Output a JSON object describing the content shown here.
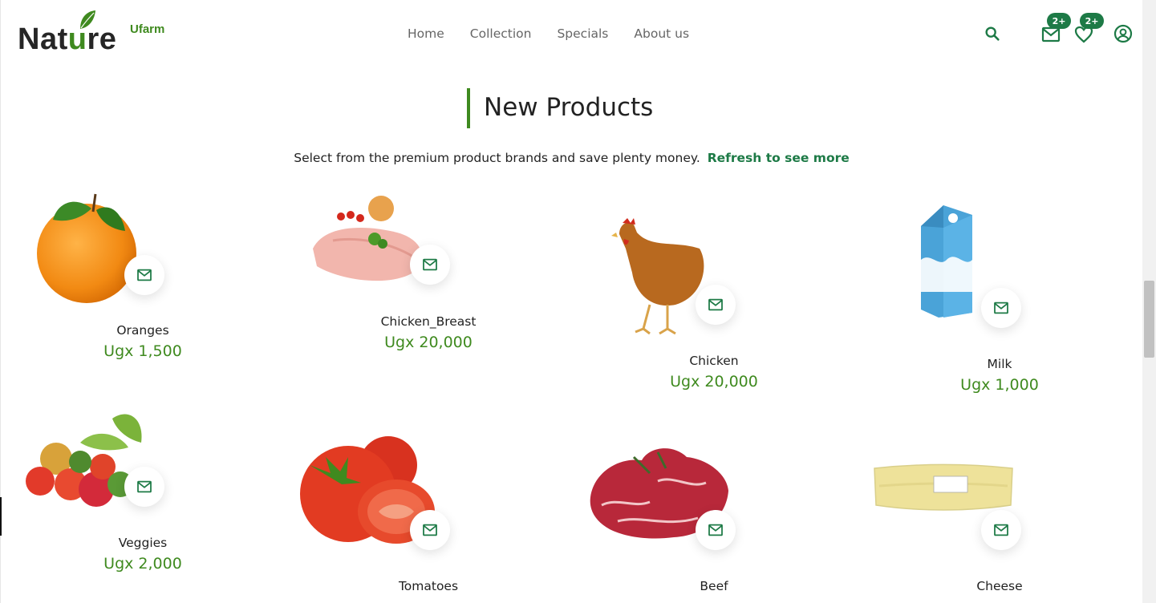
{
  "brand": {
    "name_start": "Nat",
    "name_accent": "u",
    "name_end": "re",
    "sub": "Ufarm"
  },
  "nav": [
    {
      "label": "Home"
    },
    {
      "label": "Collection"
    },
    {
      "label": "Specials"
    },
    {
      "label": "About us"
    }
  ],
  "header_icons": {
    "search": "search-icon",
    "mail": {
      "icon": "mail-icon",
      "badge": "2+"
    },
    "wishlist": {
      "icon": "heart-icon",
      "badge": "2+"
    },
    "account": "user-circle-icon"
  },
  "section": {
    "title": "New Products",
    "subtitle": "Select from the premium product brands and save plenty money.",
    "refresh_link": "Refresh to see more"
  },
  "products": [
    {
      "name": "Oranges",
      "price": "Ugx 1,500"
    },
    {
      "name": "Chicken_Breast",
      "price": "Ugx 20,000"
    },
    {
      "name": "Chicken",
      "price": "Ugx 20,000"
    },
    {
      "name": "Milk",
      "price": "Ugx 1,000"
    },
    {
      "name": "Veggies",
      "price": "Ugx 2,000"
    },
    {
      "name": "Tomatoes",
      "price": ""
    },
    {
      "name": "Beef",
      "price": ""
    },
    {
      "name": "Cheese",
      "price": ""
    }
  ],
  "colors": {
    "accent": "#3f8a1f",
    "badge": "#1d7a46",
    "text": "#222222"
  }
}
